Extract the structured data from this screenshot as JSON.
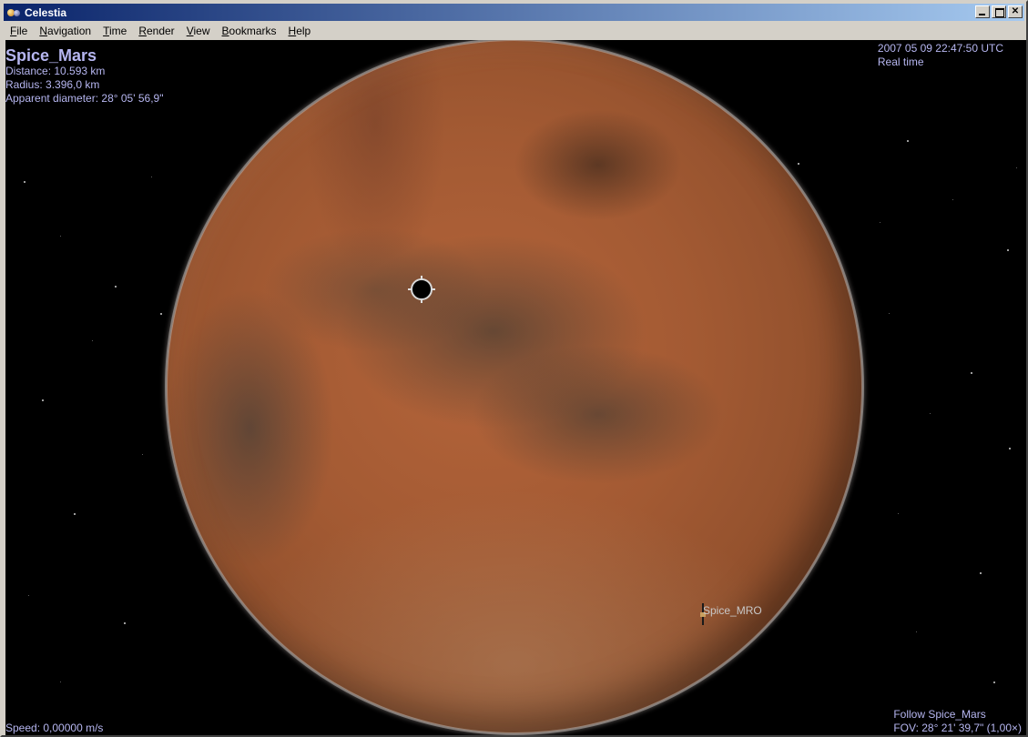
{
  "window": {
    "title": "Celestia"
  },
  "menu": {
    "items": [
      {
        "accel": "F",
        "rest": "ile"
      },
      {
        "accel": "N",
        "rest": "avigation"
      },
      {
        "accel": "T",
        "rest": "ime"
      },
      {
        "accel": "R",
        "rest": "ender"
      },
      {
        "accel": "V",
        "rest": "iew"
      },
      {
        "accel": "B",
        "rest": "ookmarks"
      },
      {
        "accel": "H",
        "rest": "elp"
      }
    ]
  },
  "hud": {
    "object_name": "Spice_Mars",
    "distance": "Distance: 10.593 km",
    "radius": "Radius: 3.396,0 km",
    "apparent_diameter": "Apparent diameter: 28° 05' 56,9\"",
    "datetime": "2007 05 09 22:47:50 UTC",
    "time_mode": "Real time",
    "speed": "Speed: 0,00000 m/s",
    "follow": "Follow Spice_Mars",
    "fov": "FOV: 28° 21' 39,7\" (1,00×)"
  },
  "scene": {
    "spacecraft_label": "Spice_MRO",
    "planet_color": "#a35a33"
  }
}
